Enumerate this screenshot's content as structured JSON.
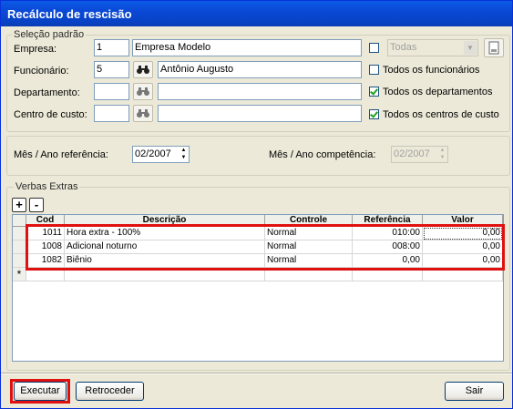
{
  "window": {
    "title": "Recálculo de rescisão"
  },
  "selecao": {
    "group_label": "Seleção padrão",
    "empresa_label": "Empresa:",
    "empresa_code": "1",
    "empresa_name": "Empresa Modelo",
    "funcionario_label": "Funcionário:",
    "funcionario_code": "5",
    "funcionario_name": "Antônio Augusto",
    "departamento_label": "Departamento:",
    "departamento_code": "",
    "departamento_name": "",
    "centro_label": "Centro de custo:",
    "centro_code": "",
    "centro_name": "",
    "todas_select": "Todas",
    "todas_checked": false,
    "todos_funcionarios_label": "Todos os funcionários",
    "todos_funcionarios_checked": false,
    "todos_departamentos_label": "Todos os departamentos",
    "todos_departamentos_checked": true,
    "todos_centros_label": "Todos os centros de custo",
    "todos_centros_checked": true
  },
  "periodo": {
    "referencia_label": "Mês / Ano referência:",
    "referencia_value": "02/2007",
    "competencia_label": "Mês / Ano competência:",
    "competencia_value": "02/2007"
  },
  "verbas": {
    "group_label": "Verbas Extras",
    "add_label": "+",
    "remove_label": "-",
    "columns": [
      "Cod",
      "Descrição",
      "Controle",
      "Referência",
      "Valor"
    ],
    "rows": [
      {
        "cod": "1011",
        "descricao": "Hora extra - 100%",
        "controle": "Normal",
        "referencia": "010:00",
        "valor": "0,00"
      },
      {
        "cod": "1008",
        "descricao": "Adicional noturno",
        "controle": "Normal",
        "referencia": "008:00",
        "valor": "0,00"
      },
      {
        "cod": "1082",
        "descricao": "Biênio",
        "controle": "Normal",
        "referencia": "0,00",
        "valor": "0,00"
      }
    ],
    "new_row_marker": "*"
  },
  "footer": {
    "executar_label": "Executar",
    "retroceder_label": "Retroceder",
    "sair_label": "Sair"
  },
  "colors": {
    "highlight": "#e01010",
    "titlebar": "#0a49d6"
  }
}
